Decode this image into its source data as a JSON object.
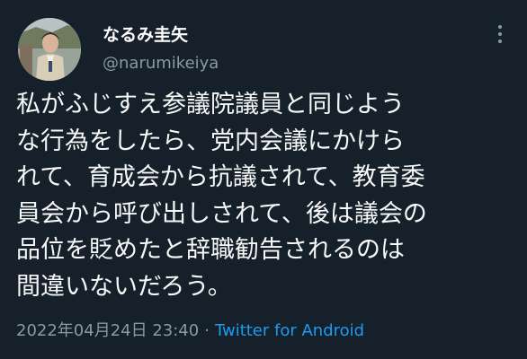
{
  "author": {
    "display_name": "なるみ圭矢",
    "handle": "@narumikeiya"
  },
  "tweet": {
    "lines": [
      "私がふじすえ参議院議員と同じよう",
      "な行為をしたら、党内会議にかけら",
      "れて、育成会から抗議されて、教育委",
      "員会から呼び出しされて、後は議会の",
      "品位を貶めたと辞職勧告されるのは",
      "間違いないだろう。"
    ]
  },
  "meta": {
    "timestamp": "2022年04月24日 23:40",
    "separator": "·",
    "source": "Twitter for Android"
  },
  "icons": {
    "more": "more-vertical-icon",
    "avatar": "profile-photo"
  },
  "colors": {
    "background": "#15202b",
    "text": "#f7f9f9",
    "secondary": "#8b98a5",
    "link": "#1d9bf0"
  }
}
